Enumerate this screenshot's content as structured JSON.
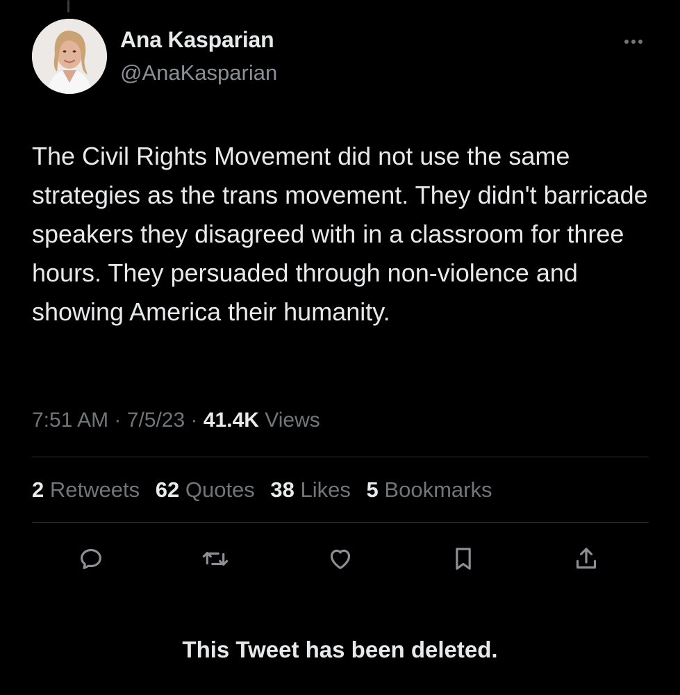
{
  "author": {
    "display_name": "Ana Kasparian",
    "handle": "@AnaKasparian",
    "avatar_icon": "profile-photo"
  },
  "tweet": {
    "text": "The Civil Rights Movement did not use the same strategies as the trans movement. They didn't barricade speakers they disagreed with in a classroom for three hours. They persuaded through non-violence and showing America their humanity.",
    "time": "7:51 AM",
    "separator": "·",
    "date": "7/5/23",
    "views_count": "41.4K",
    "views_label": "Views"
  },
  "stats": {
    "retweets_count": "2",
    "retweets_label": "Retweets",
    "quotes_count": "62",
    "quotes_label": "Quotes",
    "likes_count": "38",
    "likes_label": "Likes",
    "bookmarks_count": "5",
    "bookmarks_label": "Bookmarks"
  },
  "actions": [
    {
      "icon": "reply-icon"
    },
    {
      "icon": "retweet-icon"
    },
    {
      "icon": "like-icon"
    },
    {
      "icon": "bookmark-icon"
    },
    {
      "icon": "share-icon"
    }
  ],
  "notice": "This Tweet has been deleted.",
  "colors": {
    "background": "#000000",
    "primary_text": "#e7e9ea",
    "secondary_text": "#71767b",
    "divider": "#2f3336"
  }
}
